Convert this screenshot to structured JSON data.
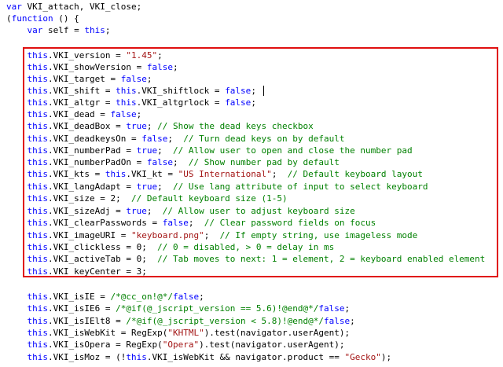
{
  "code_lines": [
    [
      [
        "kw",
        "var"
      ],
      [
        "plain",
        " VKI_attach, VKI_close;"
      ]
    ],
    [
      [
        "plain",
        "("
      ],
      [
        "kw",
        "function"
      ],
      [
        "plain",
        " () {"
      ]
    ],
    [
      [
        "plain",
        "    "
      ],
      [
        "kw",
        "var"
      ],
      [
        "plain",
        " self = "
      ],
      [
        "kw",
        "this"
      ],
      [
        "plain",
        ";"
      ]
    ],
    [],
    [
      [
        "plain",
        "    "
      ],
      [
        "kw",
        "this"
      ],
      [
        "plain",
        ".VKI_version = "
      ],
      [
        "str",
        "\"1.45\""
      ],
      [
        "plain",
        ";"
      ]
    ],
    [
      [
        "plain",
        "    "
      ],
      [
        "kw",
        "this"
      ],
      [
        "plain",
        ".VKI_showVersion = "
      ],
      [
        "kw",
        "false"
      ],
      [
        "plain",
        ";"
      ]
    ],
    [
      [
        "plain",
        "    "
      ],
      [
        "kw",
        "this"
      ],
      [
        "plain",
        ".VKI_target = "
      ],
      [
        "kw",
        "false"
      ],
      [
        "plain",
        ";"
      ]
    ],
    [
      [
        "plain",
        "    "
      ],
      [
        "kw",
        "this"
      ],
      [
        "plain",
        ".VKI_shift = "
      ],
      [
        "kw",
        "this"
      ],
      [
        "plain",
        ".VKI_shiftlock = "
      ],
      [
        "kw",
        "false"
      ],
      [
        "plain",
        ";"
      ]
    ],
    [
      [
        "plain",
        "    "
      ],
      [
        "kw",
        "this"
      ],
      [
        "plain",
        ".VKI_altgr = "
      ],
      [
        "kw",
        "this"
      ],
      [
        "plain",
        ".VKI_altgrlock = "
      ],
      [
        "kw",
        "false"
      ],
      [
        "plain",
        ";"
      ]
    ],
    [
      [
        "plain",
        "    "
      ],
      [
        "kw",
        "this"
      ],
      [
        "plain",
        ".VKI_dead = "
      ],
      [
        "kw",
        "false"
      ],
      [
        "plain",
        ";"
      ]
    ],
    [
      [
        "plain",
        "    "
      ],
      [
        "kw",
        "this"
      ],
      [
        "plain",
        ".VKI_deadBox = "
      ],
      [
        "kw",
        "true"
      ],
      [
        "plain",
        "; "
      ],
      [
        "com",
        "// Show the dead keys checkbox"
      ]
    ],
    [
      [
        "plain",
        "    "
      ],
      [
        "kw",
        "this"
      ],
      [
        "plain",
        ".VKI_deadkeysOn = "
      ],
      [
        "kw",
        "false"
      ],
      [
        "plain",
        ";  "
      ],
      [
        "com",
        "// Turn dead keys on by default"
      ]
    ],
    [
      [
        "plain",
        "    "
      ],
      [
        "kw",
        "this"
      ],
      [
        "plain",
        ".VKI_numberPad = "
      ],
      [
        "kw",
        "true"
      ],
      [
        "plain",
        ";  "
      ],
      [
        "com",
        "// Allow user to open and close the number pad"
      ]
    ],
    [
      [
        "plain",
        "    "
      ],
      [
        "kw",
        "this"
      ],
      [
        "plain",
        ".VKI_numberPadOn = "
      ],
      [
        "kw",
        "false"
      ],
      [
        "plain",
        ";  "
      ],
      [
        "com",
        "// Show number pad by default"
      ]
    ],
    [
      [
        "plain",
        "    "
      ],
      [
        "kw",
        "this"
      ],
      [
        "plain",
        ".VKI_kts = "
      ],
      [
        "kw",
        "this"
      ],
      [
        "plain",
        ".VKI_kt = "
      ],
      [
        "str",
        "\"US International\""
      ],
      [
        "plain",
        ";  "
      ],
      [
        "com",
        "// Default keyboard layout"
      ]
    ],
    [
      [
        "plain",
        "    "
      ],
      [
        "kw",
        "this"
      ],
      [
        "plain",
        ".VKI_langAdapt = "
      ],
      [
        "kw",
        "true"
      ],
      [
        "plain",
        ";  "
      ],
      [
        "com",
        "// Use lang attribute of input to select keyboard"
      ]
    ],
    [
      [
        "plain",
        "    "
      ],
      [
        "kw",
        "this"
      ],
      [
        "plain",
        ".VKI_size = 2;  "
      ],
      [
        "com",
        "// Default keyboard size (1-5)"
      ]
    ],
    [
      [
        "plain",
        "    "
      ],
      [
        "kw",
        "this"
      ],
      [
        "plain",
        ".VKI_sizeAdj = "
      ],
      [
        "kw",
        "true"
      ],
      [
        "plain",
        ";  "
      ],
      [
        "com",
        "// Allow user to adjust keyboard size"
      ]
    ],
    [
      [
        "plain",
        "    "
      ],
      [
        "kw",
        "this"
      ],
      [
        "plain",
        ".VKI_clearPasswords = "
      ],
      [
        "kw",
        "false"
      ],
      [
        "plain",
        ";  "
      ],
      [
        "com",
        "// Clear password fields on focus"
      ]
    ],
    [
      [
        "plain",
        "    "
      ],
      [
        "kw",
        "this"
      ],
      [
        "plain",
        ".VKI_imageURI = "
      ],
      [
        "str",
        "\"keyboard.png\""
      ],
      [
        "plain",
        ";  "
      ],
      [
        "com",
        "// If empty string, use imageless mode"
      ]
    ],
    [
      [
        "plain",
        "    "
      ],
      [
        "kw",
        "this"
      ],
      [
        "plain",
        ".VKI_clickless = 0;  "
      ],
      [
        "com",
        "// 0 = disabled, > 0 = delay in ms"
      ]
    ],
    [
      [
        "plain",
        "    "
      ],
      [
        "kw",
        "this"
      ],
      [
        "plain",
        ".VKI_activeTab = 0;  "
      ],
      [
        "com",
        "// Tab moves to next: 1 = element, 2 = keyboard enabled element"
      ]
    ],
    [
      [
        "plain",
        "    "
      ],
      [
        "kw",
        "this"
      ],
      [
        "plain",
        ".VKI_keyCenter = 3;"
      ]
    ],
    [],
    [
      [
        "plain",
        "    "
      ],
      [
        "kw",
        "this"
      ],
      [
        "plain",
        ".VKI_isIE = "
      ],
      [
        "com",
        "/*@cc_on!@*/"
      ],
      [
        "kw",
        "false"
      ],
      [
        "plain",
        ";"
      ]
    ],
    [
      [
        "plain",
        "    "
      ],
      [
        "kw",
        "this"
      ],
      [
        "plain",
        ".VKI_isIE6 = "
      ],
      [
        "com",
        "/*@if(@_jscript_version == 5.6)!@end@*/"
      ],
      [
        "kw",
        "false"
      ],
      [
        "plain",
        ";"
      ]
    ],
    [
      [
        "plain",
        "    "
      ],
      [
        "kw",
        "this"
      ],
      [
        "plain",
        ".VKI_isIElt8 = "
      ],
      [
        "com",
        "/*@if(@_jscript_version < 5.8)!@end@*/"
      ],
      [
        "kw",
        "false"
      ],
      [
        "plain",
        ";"
      ]
    ],
    [
      [
        "plain",
        "    "
      ],
      [
        "kw",
        "this"
      ],
      [
        "plain",
        ".VKI_isWebKit = RegExp("
      ],
      [
        "str",
        "\"KHTML\""
      ],
      [
        "plain",
        ").test(navigator.userAgent);"
      ]
    ],
    [
      [
        "plain",
        "    "
      ],
      [
        "kw",
        "this"
      ],
      [
        "plain",
        ".VKI_isOpera = RegExp("
      ],
      [
        "str",
        "\"Opera\""
      ],
      [
        "plain",
        ").test(navigator.userAgent);"
      ]
    ],
    [
      [
        "plain",
        "    "
      ],
      [
        "kw",
        "this"
      ],
      [
        "plain",
        ".VKI_isMoz = (!"
      ],
      [
        "kw",
        "this"
      ],
      [
        "plain",
        ".VKI_isWebKit && navigator.product == "
      ],
      [
        "str",
        "\"Gecko\""
      ],
      [
        "plain",
        ");"
      ]
    ]
  ],
  "colors": {
    "keyword": "#0000ff",
    "string": "#a31515",
    "comment": "#008000",
    "highlight_border": "#e01010"
  }
}
